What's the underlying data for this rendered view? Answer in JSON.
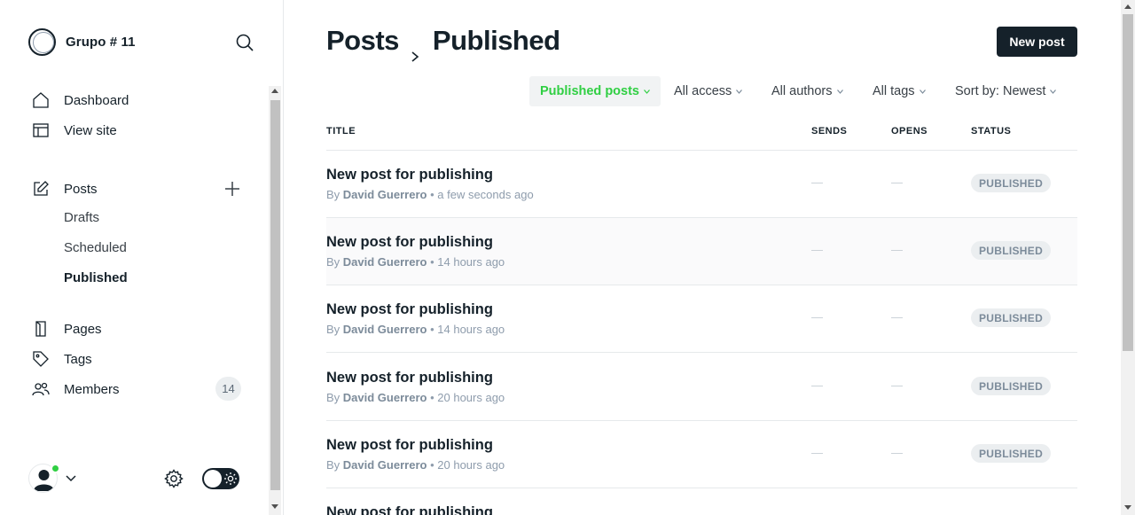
{
  "brand": {
    "name": "Grupo # 11"
  },
  "nav": {
    "dashboard": "Dashboard",
    "view_site": "View site",
    "posts": "Posts",
    "drafts": "Drafts",
    "scheduled": "Scheduled",
    "published": "Published",
    "pages": "Pages",
    "tags": "Tags",
    "members": "Members",
    "members_count": "14"
  },
  "header": {
    "crumb_parent": "Posts",
    "crumb_current": "Published",
    "new_post_label": "New post"
  },
  "filters": {
    "type": "Published posts",
    "access": "All access",
    "authors": "All authors",
    "tags": "All tags",
    "sort": "Sort by: Newest"
  },
  "table": {
    "columns": {
      "title": "TITLE",
      "sends": "SENDS",
      "opens": "OPENS",
      "status": "STATUS"
    },
    "rows": [
      {
        "title": "New post for publishing",
        "by": "By",
        "author": "David Guerrero",
        "sep": "•",
        "time": "a few seconds ago",
        "sends": "—",
        "opens": "—",
        "status": "PUBLISHED"
      },
      {
        "title": "New post for publishing",
        "by": "By",
        "author": "David Guerrero",
        "sep": "•",
        "time": "14 hours ago",
        "sends": "—",
        "opens": "—",
        "status": "PUBLISHED"
      },
      {
        "title": "New post for publishing",
        "by": "By",
        "author": "David Guerrero",
        "sep": "•",
        "time": "14 hours ago",
        "sends": "—",
        "opens": "—",
        "status": "PUBLISHED"
      },
      {
        "title": "New post for publishing",
        "by": "By",
        "author": "David Guerrero",
        "sep": "•",
        "time": "20 hours ago",
        "sends": "—",
        "opens": "—",
        "status": "PUBLISHED"
      },
      {
        "title": "New post for publishing",
        "by": "By",
        "author": "David Guerrero",
        "sep": "•",
        "time": "20 hours ago",
        "sends": "—",
        "opens": "—",
        "status": "PUBLISHED"
      },
      {
        "title": "New post for publishing"
      }
    ]
  },
  "colors": {
    "accent_green": "#30cf43",
    "primary_dark": "#15212a",
    "muted": "#8e9cac"
  },
  "icons": [
    "search-icon",
    "home-icon",
    "view-site-icon",
    "posts-edit-icon",
    "plus-icon",
    "pages-icon",
    "tag-icon",
    "members-icon",
    "gear-icon",
    "chevron-down-icon",
    "sun-icon",
    "chevron-right-icon"
  ]
}
